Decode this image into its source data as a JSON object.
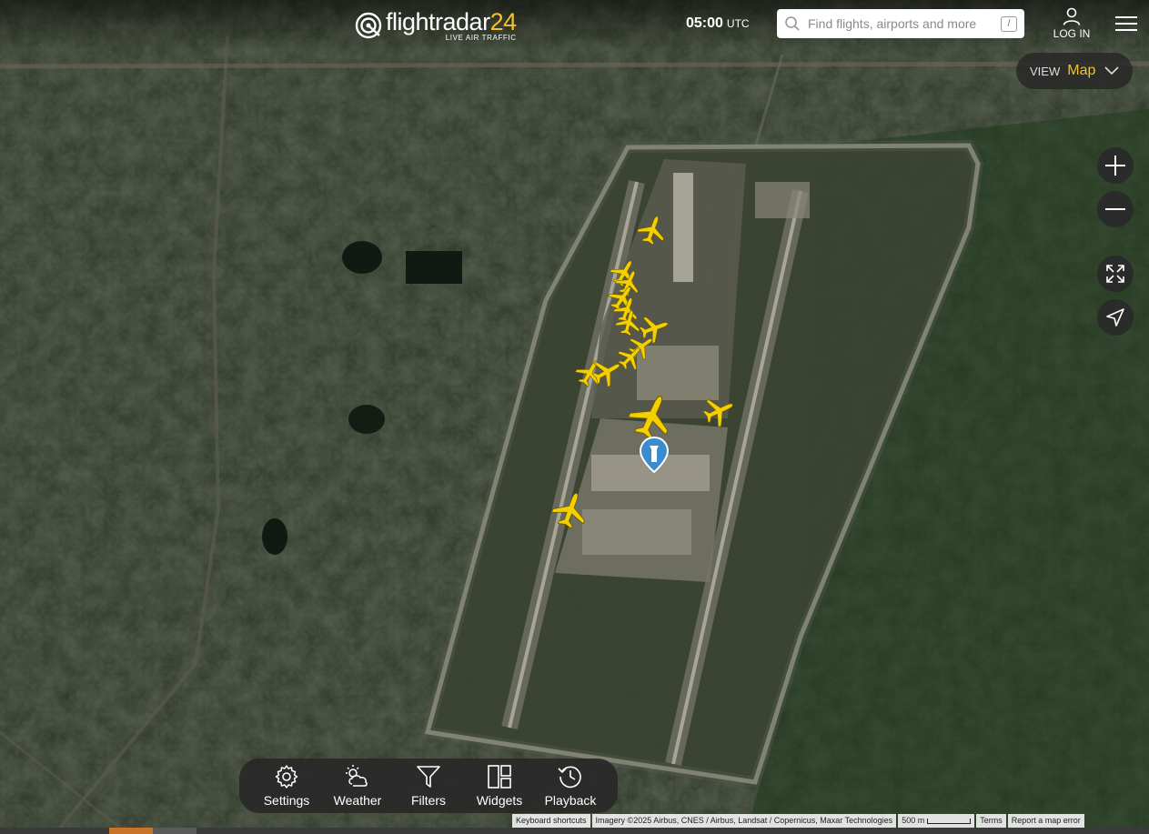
{
  "header": {
    "logo_main": "flightradar",
    "logo_num": "24",
    "logo_tagline": "LIVE AIR TRAFFIC",
    "clock_time": "05:00",
    "clock_tz": "UTC",
    "search_placeholder": "Find flights, airports and more",
    "search_shortcut": "/",
    "login_label": "LOG IN"
  },
  "view": {
    "label": "VIEW",
    "value": "Map"
  },
  "bottom_nav": [
    {
      "label": "Settings",
      "icon": "gear-icon"
    },
    {
      "label": "Weather",
      "icon": "weather-icon"
    },
    {
      "label": "Filters",
      "icon": "filter-icon"
    },
    {
      "label": "Widgets",
      "icon": "widgets-icon"
    },
    {
      "label": "Playback",
      "icon": "history-icon"
    }
  ],
  "attribution": {
    "shortcuts": "Keyboard shortcuts",
    "imagery": "Imagery ©2025 Airbus, CNES / Airbus, Landsat / Copernicus, Maxar Technologies",
    "scale": "500 m",
    "terms": "Terms",
    "report": "Report a map error"
  },
  "colors": {
    "accent": "#f4c228",
    "aircraft": "#f4d000",
    "airport_pin": "#3a8bd0"
  }
}
